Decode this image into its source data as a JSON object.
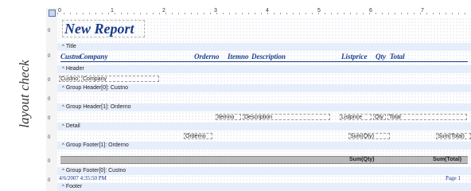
{
  "watermark": "layout check",
  "ruler": {
    "marks": [
      "0",
      "1",
      "2",
      "3",
      "4",
      "5",
      "6",
      "7"
    ],
    "zero": "0"
  },
  "report_header": {
    "title": "New Report",
    "columns": [
      "Custno",
      "Company",
      "Orderno",
      "Itemno",
      "Description",
      "Listprice",
      "Qty",
      "Total"
    ]
  },
  "bands": {
    "title": "Title",
    "header": "Header",
    "group_header_0": "Group Header[0]: Custno",
    "group_header_1": "Group Header[1]: Orderno",
    "detail": "Detail",
    "group_footer_1": "Group Footer[1]: Orderno",
    "group_footer_0": "Group Footer[0]: Custno",
    "footer": "Footer"
  },
  "fields": {
    "custno": "Custno",
    "company": "Company",
    "itemno": "Itemno",
    "description": "Description",
    "listprice": "Listprice",
    "qty": "Qty",
    "total": "Total",
    "orderno": "Orderno",
    "sum_qty": "Sum(Qty)",
    "sum_total": "Sum(Total)"
  },
  "summary": {
    "sum_qty": "Sum(Qty)",
    "sum_total": "Sum(Total)"
  },
  "footer": {
    "date": "4/6/2007 4:35:50 PM",
    "page": "Page 1"
  }
}
